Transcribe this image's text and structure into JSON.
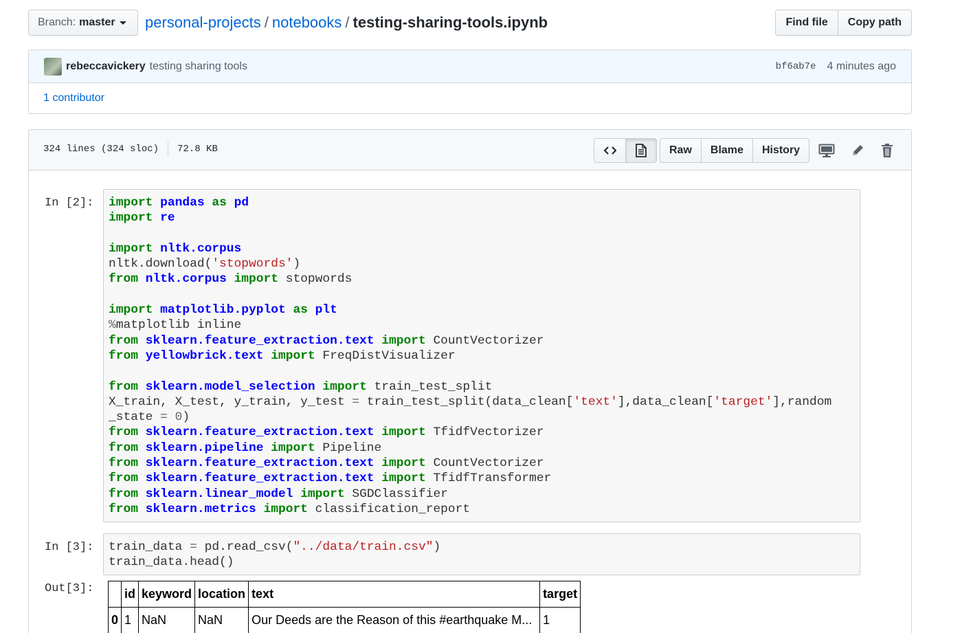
{
  "file_nav": {
    "branch_label": "Branch:",
    "branch_value": "master",
    "breadcrumb": {
      "repo": "personal-projects",
      "sep1": "/",
      "folder": "notebooks",
      "sep2": "/",
      "file": "testing-sharing-tools.ipynb"
    },
    "find_file": "Find file",
    "copy_path": "Copy path"
  },
  "commit": {
    "author": "rebeccavickery",
    "message": "testing sharing tools",
    "sha": "bf6ab7e",
    "time": "4 minutes ago",
    "contributors": "1 contributor"
  },
  "file_header": {
    "lines": "324 lines (324 sloc)",
    "size": "72.8 KB",
    "raw": "Raw",
    "blame": "Blame",
    "history": "History",
    "icons": [
      "code-icon",
      "file-icon",
      "desktop-icon",
      "pencil-icon",
      "trash-icon"
    ]
  },
  "cells": [
    {
      "prompt": "In [2]:",
      "code": [
        "import pandas as pd",
        "import re",
        "",
        "import nltk.corpus",
        "nltk.download('stopwords')",
        "from nltk.corpus import stopwords",
        "",
        "import matplotlib.pyplot as plt",
        "%matplotlib inline",
        "from sklearn.feature_extraction.text import CountVectorizer",
        "from yellowbrick.text import FreqDistVisualizer",
        "",
        "from sklearn.model_selection import train_test_split",
        "X_train, X_test, y_train, y_test = train_test_split(data_clean['text'],data_clean['target'],random",
        "_state = 0)",
        "from sklearn.feature_extraction.text import TfidfVectorizer",
        "from sklearn.pipeline import Pipeline",
        "from sklearn.feature_extraction.text import CountVectorizer",
        "from sklearn.feature_extraction.text import TfidfTransformer",
        "from sklearn.linear_model import SGDClassifier",
        "from sklearn.metrics import classification_report"
      ]
    },
    {
      "prompt": "In [3]:",
      "code": [
        "train_data = pd.read_csv(\"../data/train.csv\")",
        "train_data.head()"
      ]
    }
  ],
  "output": {
    "prompt": "Out[3]:",
    "columns": [
      "",
      "id",
      "keyword",
      "location",
      "text",
      "target"
    ],
    "rows": [
      [
        "0",
        "1",
        "NaN",
        "NaN",
        "Our Deeds are the Reason of this #earthquake M...",
        "1"
      ]
    ]
  }
}
